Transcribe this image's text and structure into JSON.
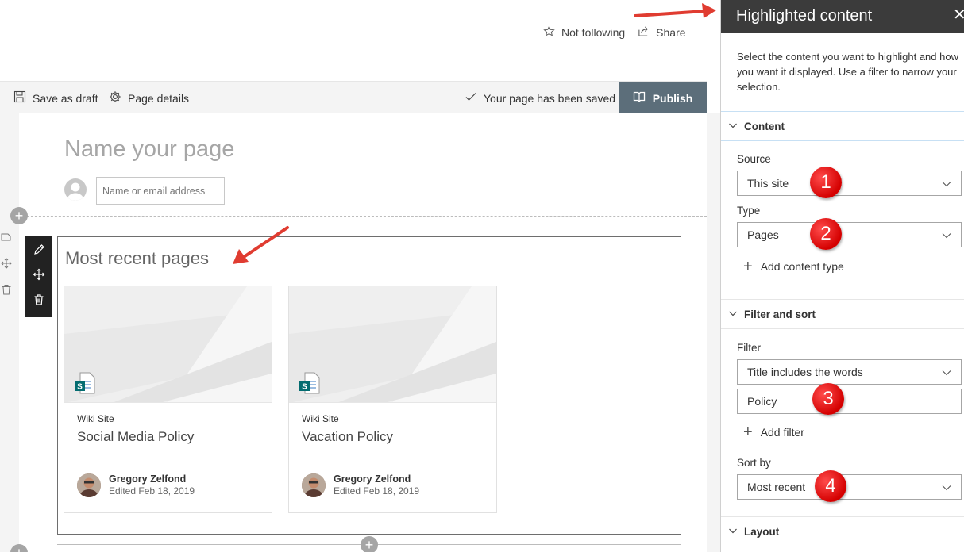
{
  "top_actions": {
    "follow_label": "Not following",
    "share_label": "Share"
  },
  "command_bar": {
    "save_draft_label": "Save as draft",
    "page_details_label": "Page details",
    "saved_status": "Your page has been saved",
    "publish_label": "Publish"
  },
  "page": {
    "title_placeholder": "Name your page",
    "author_placeholder": "Name or email address"
  },
  "webpart": {
    "title": "Most recent pages",
    "cards": [
      {
        "site": "Wiki Site",
        "title": "Social Media Policy",
        "author": "Gregory Zelfond",
        "edited": "Edited Feb 18, 2019"
      },
      {
        "site": "Wiki Site",
        "title": "Vacation Policy",
        "author": "Gregory Zelfond",
        "edited": "Edited Feb 18, 2019"
      }
    ]
  },
  "panel": {
    "title": "Highlighted content",
    "description": "Select the content you want to highlight and how you want it displayed. Use a filter to narrow your selection.",
    "sections": {
      "content": {
        "heading": "Content",
        "source_label": "Source",
        "source_value": "This site",
        "type_label": "Type",
        "type_value": "Pages",
        "add_type_label": "Add content type"
      },
      "filter_sort": {
        "heading": "Filter and sort",
        "filter_label": "Filter",
        "filter_value": "Title includes the words",
        "filter_text": "Policy",
        "add_filter_label": "Add filter",
        "sort_label": "Sort by",
        "sort_value": "Most recent"
      },
      "layout": {
        "heading": "Layout"
      }
    }
  },
  "badges": [
    "1",
    "2",
    "3",
    "4"
  ],
  "colors": {
    "publish": "#5c6e7a",
    "panel_header": "#3b3b3b",
    "badge": "#d40000",
    "arrow": "#e03c31"
  }
}
